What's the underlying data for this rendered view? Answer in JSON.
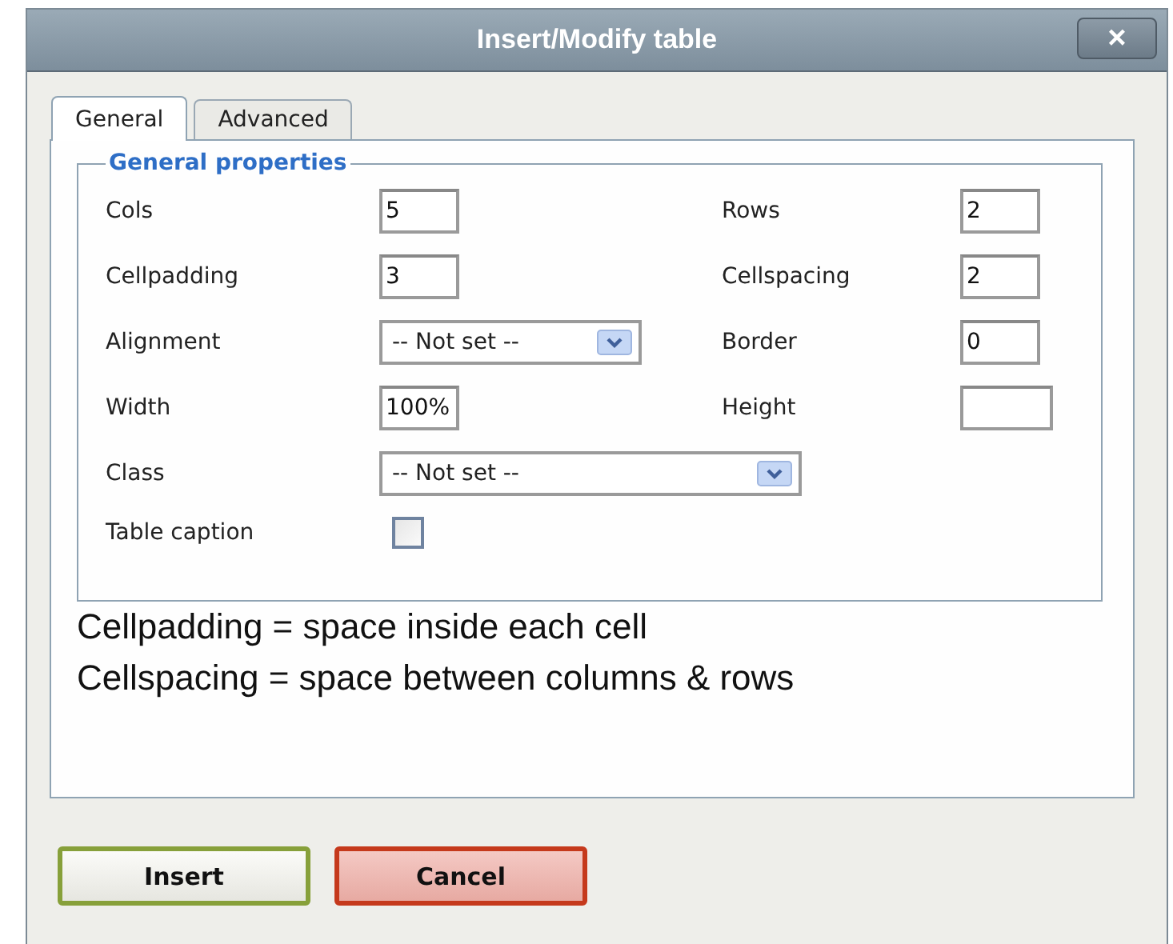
{
  "window": {
    "title": "Insert/Modify table",
    "close": "×"
  },
  "tabs": [
    {
      "label": "General",
      "selected": true
    },
    {
      "label": "Advanced",
      "selected": false
    }
  ],
  "fieldset": {
    "legend": "General properties",
    "rows": [
      {
        "left": {
          "label": "Cols",
          "kind": "text",
          "value": "5"
        },
        "right": {
          "label": "Rows",
          "kind": "text",
          "value": "2"
        }
      },
      {
        "left": {
          "label": "Cellpadding",
          "kind": "text",
          "value": "3"
        },
        "right": {
          "label": "Cellspacing",
          "kind": "text",
          "value": "2"
        }
      },
      {
        "left": {
          "label": "Alignment",
          "kind": "select",
          "value": "-- Not set --"
        },
        "right": {
          "label": "Border",
          "kind": "text",
          "value": "0"
        }
      },
      {
        "left": {
          "label": "Width",
          "kind": "text",
          "value": "100%"
        },
        "right": {
          "label": "Height",
          "kind": "text"
        }
      },
      {
        "left": {
          "label": "Class",
          "kind": "select",
          "value": "-- Not set --"
        }
      },
      {
        "left": {
          "label": "Table caption",
          "kind": "checkbox",
          "checked": false
        }
      }
    ]
  },
  "notes": [
    "Cellpadding = space inside each cell",
    "Cellspacing = space between columns & rows"
  ],
  "buttons": [
    {
      "label": "Insert",
      "kind": "ok"
    },
    {
      "label": "Cancel",
      "kind": "cancel"
    }
  ]
}
